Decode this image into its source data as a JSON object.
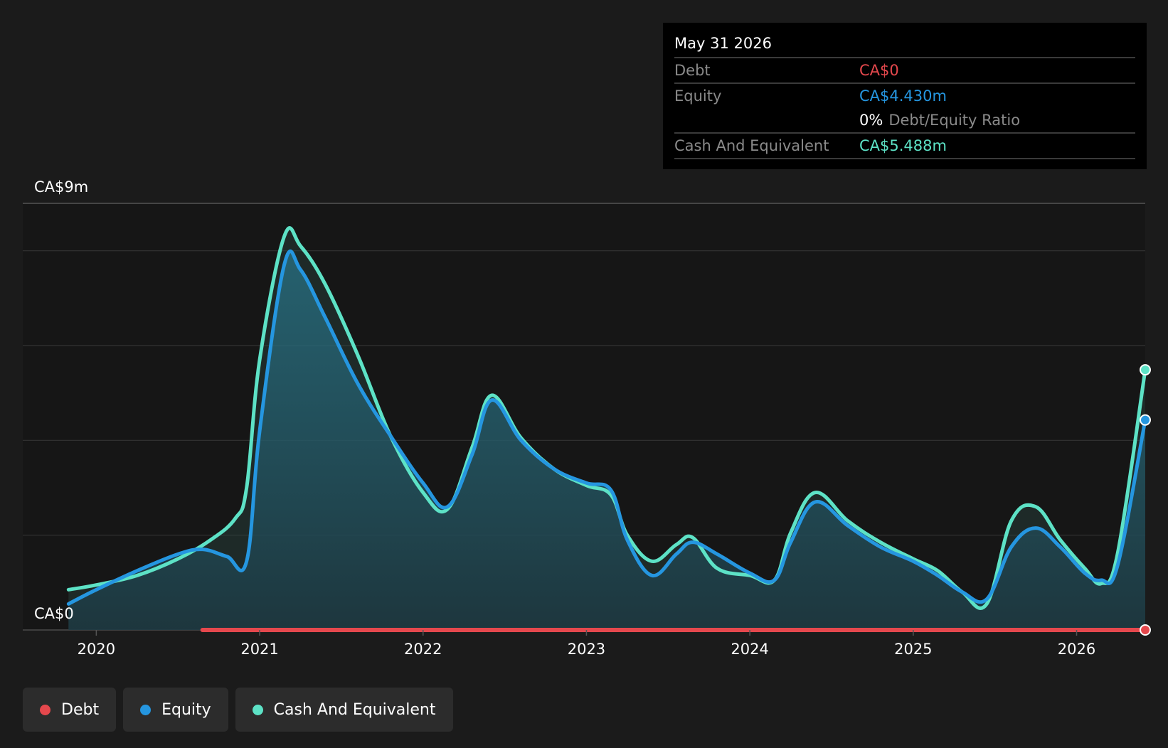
{
  "tooltip": {
    "date": "May 31 2026",
    "debt_label": "Debt",
    "debt_value": "CA$0",
    "equity_label": "Equity",
    "equity_value": "CA$4.430m",
    "ratio_value": "0%",
    "ratio_label": "Debt/Equity Ratio",
    "cash_label": "Cash And Equivalent",
    "cash_value": "CA$5.488m"
  },
  "legend": [
    {
      "label": "Debt",
      "color": "#e5484d"
    },
    {
      "label": "Equity",
      "color": "#2596e0"
    },
    {
      "label": "Cash And Equivalent",
      "color": "#5de2c6"
    }
  ],
  "chart_data": {
    "type": "area",
    "y_top_label": "CA$9m",
    "y_bottom_label": "CA$0",
    "ylim": [
      0,
      9
    ],
    "xlim": [
      2019.55,
      2026.42
    ],
    "x_ticks": [
      2020,
      2021,
      2022,
      2023,
      2024,
      2025,
      2026
    ],
    "x_tick_labels": [
      "2020",
      "2021",
      "2022",
      "2023",
      "2024",
      "2025",
      "2026"
    ],
    "grid": true,
    "legend_position": "bottom-left",
    "series": [
      {
        "name": "Debt",
        "color": "#e5484d",
        "x": [
          2020.65,
          2026.42
        ],
        "y": [
          0,
          0
        ]
      },
      {
        "name": "Equity",
        "color": "#2596e0",
        "x": [
          2019.83,
          2020.0,
          2020.25,
          2020.5,
          2020.65,
          2020.8,
          2020.92,
          2021.0,
          2021.15,
          2021.25,
          2021.4,
          2021.6,
          2021.8,
          2022.0,
          2022.15,
          2022.3,
          2022.42,
          2022.6,
          2022.8,
          2023.0,
          2023.15,
          2023.25,
          2023.4,
          2023.55,
          2023.65,
          2023.8,
          2024.0,
          2024.15,
          2024.25,
          2024.4,
          2024.6,
          2024.8,
          2025.0,
          2025.15,
          2025.3,
          2025.45,
          2025.6,
          2025.75,
          2025.9,
          2026.05,
          2026.15,
          2026.25,
          2026.42
        ],
        "y": [
          0.55,
          0.85,
          1.25,
          1.6,
          1.7,
          1.55,
          1.45,
          4.2,
          7.7,
          7.6,
          6.6,
          5.2,
          4.1,
          3.1,
          2.6,
          3.7,
          4.85,
          4.0,
          3.4,
          3.1,
          2.95,
          1.9,
          1.15,
          1.6,
          1.85,
          1.6,
          1.2,
          1.05,
          1.85,
          2.7,
          2.2,
          1.75,
          1.45,
          1.15,
          0.8,
          0.65,
          1.75,
          2.15,
          1.75,
          1.2,
          1.05,
          1.35,
          4.43
        ]
      },
      {
        "name": "Cash And Equivalent",
        "color": "#5de2c6",
        "x": [
          2019.83,
          2020.0,
          2020.25,
          2020.5,
          2020.7,
          2020.85,
          2020.92,
          2021.0,
          2021.15,
          2021.25,
          2021.4,
          2021.6,
          2021.8,
          2022.0,
          2022.15,
          2022.3,
          2022.42,
          2022.6,
          2022.8,
          2023.0,
          2023.15,
          2023.25,
          2023.4,
          2023.55,
          2023.65,
          2023.8,
          2024.0,
          2024.15,
          2024.25,
          2024.4,
          2024.6,
          2024.8,
          2025.0,
          2025.15,
          2025.3,
          2025.45,
          2025.6,
          2025.75,
          2025.9,
          2026.05,
          2026.15,
          2026.25,
          2026.42
        ],
        "y": [
          0.85,
          0.95,
          1.15,
          1.5,
          1.9,
          2.35,
          3.0,
          5.7,
          8.3,
          8.1,
          7.3,
          5.8,
          4.1,
          2.9,
          2.55,
          3.85,
          4.95,
          4.05,
          3.4,
          3.05,
          2.85,
          2.0,
          1.45,
          1.8,
          1.95,
          1.3,
          1.15,
          1.05,
          2.05,
          2.9,
          2.3,
          1.85,
          1.5,
          1.25,
          0.8,
          0.55,
          2.3,
          2.6,
          1.9,
          1.3,
          0.98,
          1.6,
          5.488
        ]
      }
    ]
  }
}
